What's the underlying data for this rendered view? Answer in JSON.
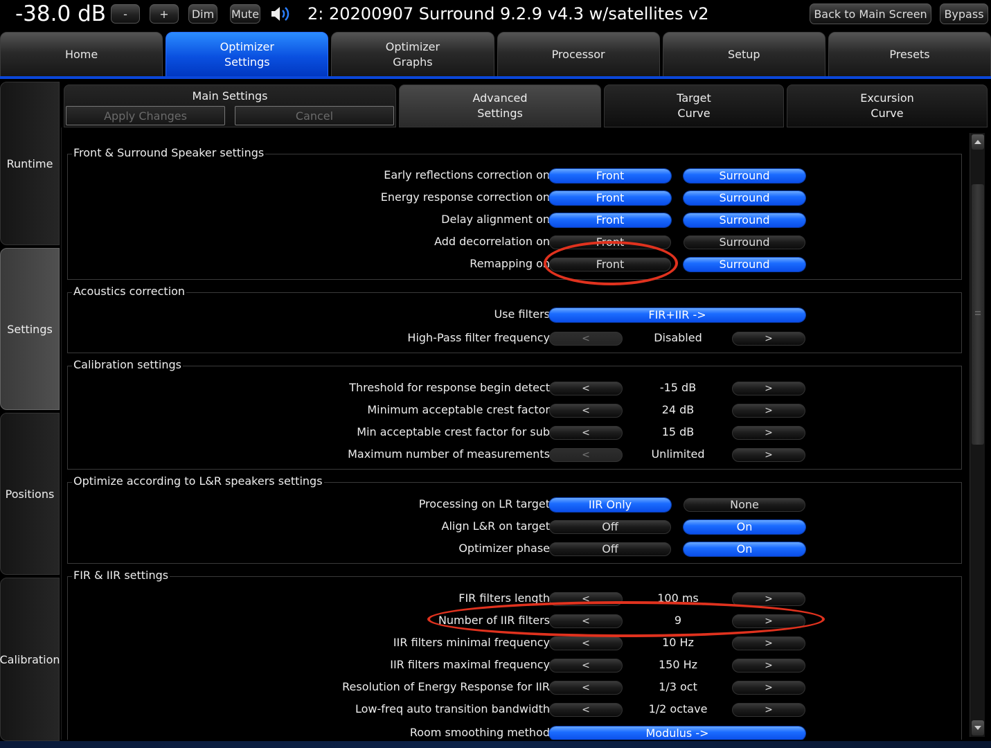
{
  "topbar": {
    "volume": "-38.0 dB",
    "minus": "-",
    "plus": "+",
    "dim": "Dim",
    "mute": "Mute",
    "preset_title": "2: 20200907 Surround 9.2.9 v4.3 w/satellites v2",
    "back": "Back to Main Screen",
    "bypass": "Bypass"
  },
  "main_tabs": [
    {
      "label": "Home",
      "active": false
    },
    {
      "label": "Optimizer\nSettings",
      "active": true
    },
    {
      "label": "Optimizer\nGraphs",
      "active": false
    },
    {
      "label": "Processor",
      "active": false
    },
    {
      "label": "Setup",
      "active": false
    },
    {
      "label": "Presets",
      "active": false
    }
  ],
  "side_tabs": [
    {
      "label": "Runtime",
      "active": false
    },
    {
      "label": "Settings",
      "active": true
    },
    {
      "label": "Positions",
      "active": false
    },
    {
      "label": "Calibration",
      "active": false
    }
  ],
  "sub_tabs": {
    "main_settings": "Main Settings",
    "apply": "Apply Changes",
    "cancel": "Cancel",
    "advanced": "Advanced\nSettings",
    "target": "Target\nCurve",
    "excursion": "Excursion\nCurve"
  },
  "groups": {
    "front_surround": {
      "title": "Front & Surround Speaker settings",
      "rows": [
        {
          "label": "Early reflections correction on",
          "a": "Front",
          "a_on": true,
          "b": "Surround",
          "b_on": true
        },
        {
          "label": "Energy response correction on",
          "a": "Front",
          "a_on": true,
          "b": "Surround",
          "b_on": true
        },
        {
          "label": "Delay alignment on",
          "a": "Front",
          "a_on": true,
          "b": "Surround",
          "b_on": true
        },
        {
          "label": "Add decorrelation on",
          "a": "Front",
          "a_on": false,
          "b": "Surround",
          "b_on": false
        },
        {
          "label": "Remapping on",
          "a": "Front",
          "a_on": false,
          "b": "Surround",
          "b_on": true
        }
      ]
    },
    "acoustics": {
      "title": "Acoustics correction",
      "use_filters_label": "Use filters",
      "use_filters_value": "FIR+IIR ->",
      "hp_label": "High-Pass filter frequency",
      "hp_value": "Disabled"
    },
    "calibration": {
      "title": "Calibration settings",
      "rows": [
        {
          "label": "Threshold for response begin detect",
          "value": "-15 dB"
        },
        {
          "label": "Minimum acceptable crest factor",
          "value": "24 dB"
        },
        {
          "label": "Min acceptable crest factor for sub",
          "value": "15 dB"
        },
        {
          "label": "Maximum number of measurements",
          "value": "Unlimited"
        }
      ]
    },
    "lr": {
      "title": "Optimize according to L&R speakers settings",
      "rows": [
        {
          "label": "Processing on LR target",
          "a": "IIR Only",
          "a_on": true,
          "b": "None",
          "b_on": false
        },
        {
          "label": "Align L&R on target",
          "a": "Off",
          "a_on": false,
          "b": "On",
          "b_on": true
        },
        {
          "label": "Optimizer phase",
          "a": "Off",
          "a_on": false,
          "b": "On",
          "b_on": true
        }
      ]
    },
    "fir_iir": {
      "title": "FIR & IIR settings",
      "rows": [
        {
          "label": "FIR filters length",
          "value": "100 ms"
        },
        {
          "label": "Number of IIR filters",
          "value": "9"
        },
        {
          "label": "IIR filters minimal frequency",
          "value": "10 Hz"
        },
        {
          "label": "IIR filters maximal frequency",
          "value": "150 Hz"
        },
        {
          "label": "Resolution of Energy Response for IIR",
          "value": "1/3 oct"
        },
        {
          "label": "Low-freq auto transition bandwidth",
          "value": "1/2 octave"
        }
      ],
      "room_label": "Room smoothing method",
      "room_value": "Modulus ->"
    }
  },
  "arrows": {
    "left": "<",
    "right": ">"
  },
  "colors": {
    "accent": "#0a50e0",
    "annotation": "#e0321e"
  }
}
